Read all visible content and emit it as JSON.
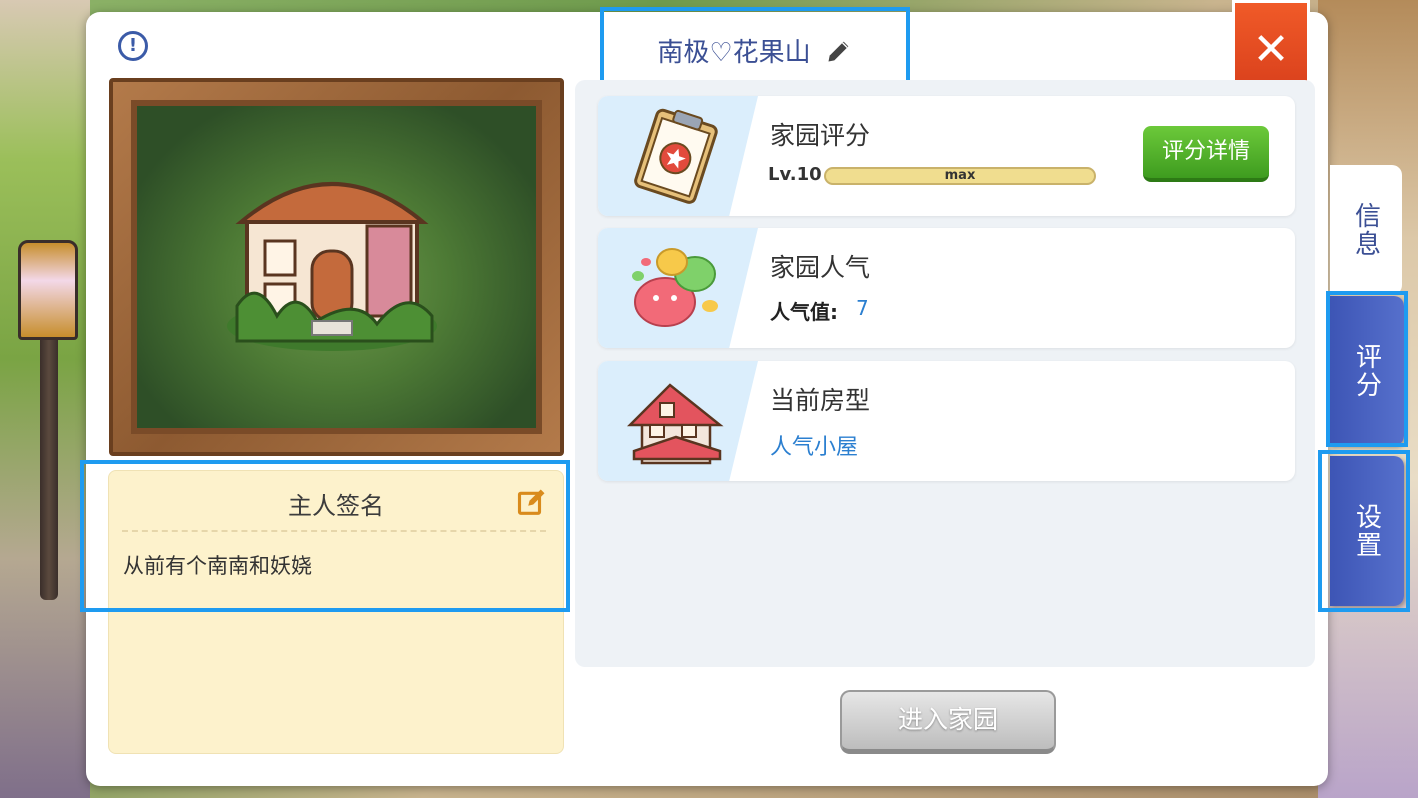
{
  "header": {
    "title": "南极♡花果山"
  },
  "close": {
    "label": "✕"
  },
  "signature": {
    "title": "主人签名",
    "text": "从前有个南南和妖娆"
  },
  "cards": {
    "rating": {
      "title": "家园评分",
      "level_label": "Lv.10",
      "level_bar_text": "max",
      "button_label": "评分详情"
    },
    "popularity": {
      "title": "家园人气",
      "label": "人气值:",
      "value": "7"
    },
    "house_type": {
      "title": "当前房型",
      "value": "人气小屋"
    }
  },
  "enter_button": {
    "label": "进入家园"
  },
  "side_tabs": [
    {
      "label": "信息",
      "active": true
    },
    {
      "label": "评分",
      "active": false
    },
    {
      "label": "设置",
      "active": false
    }
  ],
  "colors": {
    "accent_blue": "#3b4f94",
    "highlight": "#1e9bf0",
    "close_red": "#e8491f",
    "green_button": "#4fb02a",
    "link_blue": "#2b7fd0"
  },
  "icons": [
    "info-icon",
    "pencil-icon",
    "close-icon",
    "edit-note-icon",
    "clipboard-icon",
    "slime-icon",
    "house-icon"
  ]
}
